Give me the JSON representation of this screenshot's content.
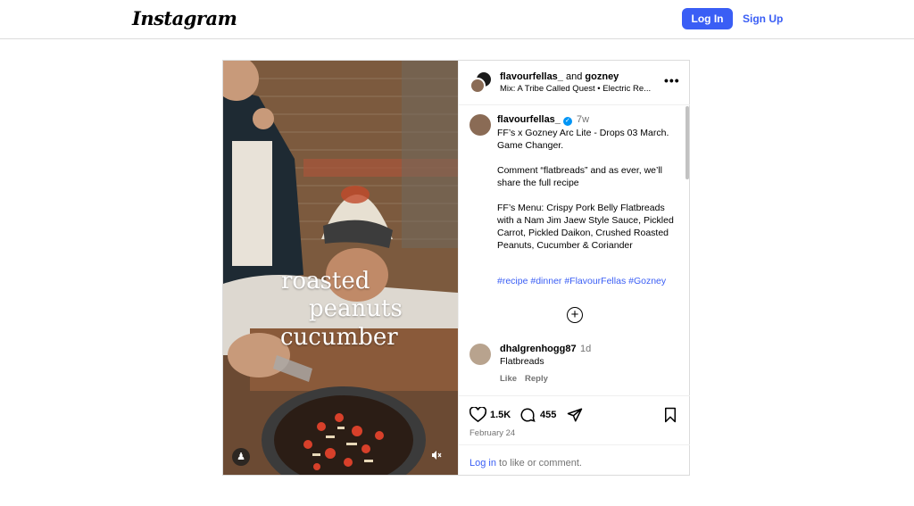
{
  "header": {
    "logo_text": "Instagram",
    "login_label": "Log In",
    "signup_label": "Sign Up"
  },
  "media": {
    "overlay_lines": [
      "roasted",
      "peanuts",
      "cucumber"
    ],
    "user_tag_icon": "person-icon",
    "mute_icon": "speaker-muted-icon"
  },
  "post_header": {
    "user1": "flavourfellas_",
    "and_word": "and",
    "user2": "gozney",
    "audio": "Mix: A Tribe Called Quest • Electric Re...",
    "more_icon": "more-options-icon"
  },
  "caption": {
    "username": "flavourfellas_",
    "time": "7w",
    "text": "FF’s x Gozney Arc Lite - Drops 03 March. Game Changer.\n\nComment “flatbreads” and as ever, we’ll share the full recipe\n\nFF’s Menu: Crispy Pork Belly Flatbreads with a Nam Jim Jaew Style Sauce, Pickled Carrot, Pickled Daikon, Crushed Roasted Peanuts, Cucumber & Coriander",
    "hashtags": [
      "#recipe",
      "#dinner",
      "#FlavourFellas",
      "#Gozney"
    ]
  },
  "comment": {
    "username": "dhalgrenhogg87",
    "time": "1d",
    "text": "Flatbreads",
    "like_label": "Like",
    "reply_label": "Reply"
  },
  "actions": {
    "likes": "1.5K",
    "comments": "455"
  },
  "date": "February 24",
  "footer": {
    "login_link": "Log in",
    "rest": " to like or comment."
  },
  "colors": {
    "accent": "#3a5ef5",
    "border": "#dbdbdb",
    "muted_text": "#737373"
  }
}
